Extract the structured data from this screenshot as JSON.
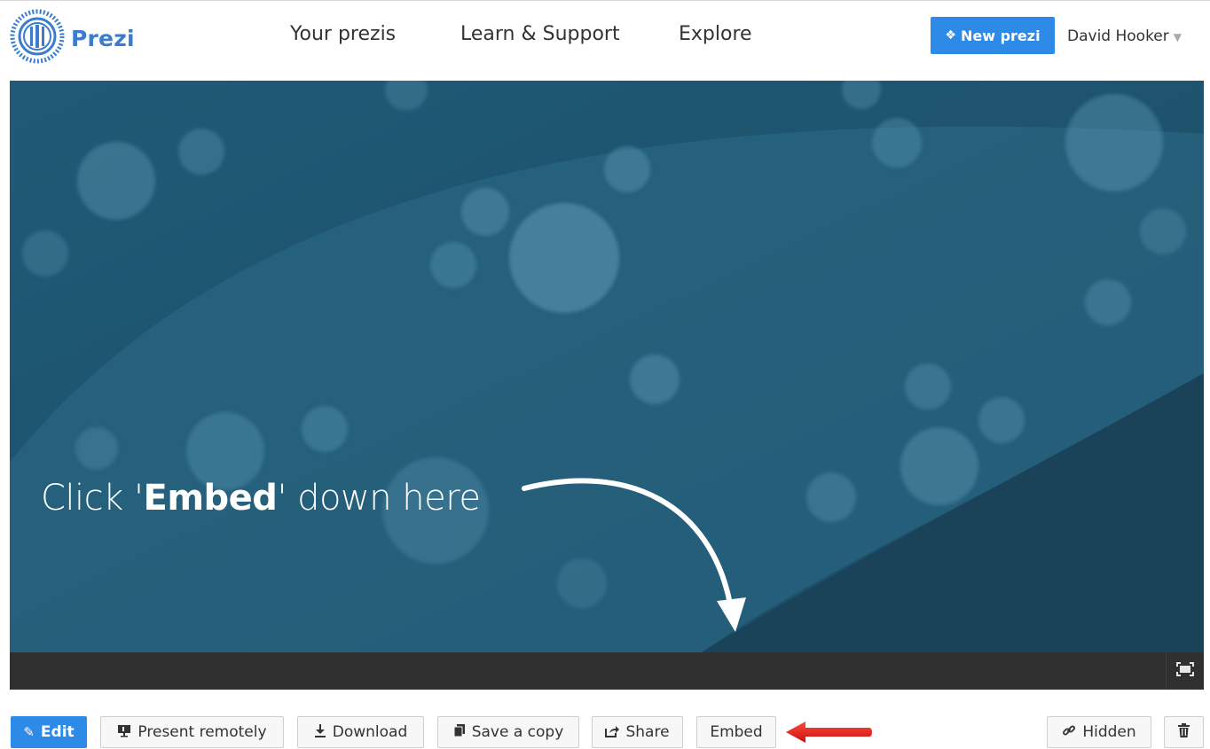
{
  "header": {
    "logo_text": "Prezi",
    "nav": [
      "Your prezis",
      "Learn & Support",
      "Explore"
    ],
    "new_button": "New prezi",
    "user_name": "David Hooker"
  },
  "stage": {
    "caption_before": "Click '",
    "caption_bold": "Embed",
    "caption_after": "' down here"
  },
  "toolbar": {
    "edit": "Edit",
    "present_remotely": "Present remotely",
    "download": "Download",
    "save_copy": "Save a copy",
    "share": "Share",
    "embed": "Embed",
    "hidden": "Hidden"
  },
  "colors": {
    "brand_blue": "#2d8ae6",
    "logo_blue": "#3a7dcc",
    "stage_bg": "#245e78",
    "player_bar": "#303030",
    "annotation_arrow": "#e02020"
  },
  "icons": [
    "prezi-logo-icon",
    "new-prezi-icon",
    "fullscreen-icon",
    "pencil-icon",
    "present-icon",
    "download-icon",
    "copy-icon",
    "share-icon",
    "link-icon",
    "trash-icon",
    "red-arrow-icon",
    "curved-arrow-icon"
  ]
}
